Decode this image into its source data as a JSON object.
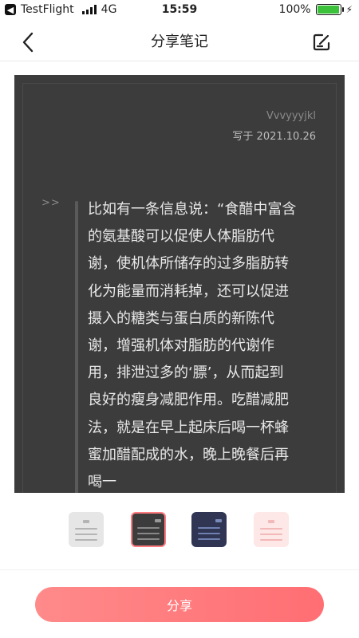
{
  "status_bar": {
    "carrier": "TestFlight",
    "network": "4G",
    "time": "15:59",
    "battery": "100%"
  },
  "header": {
    "title": "分享笔记",
    "icons": [
      "back-icon",
      "edit-icon"
    ]
  },
  "note": {
    "author": "Vvvyyyjkl",
    "date": "写于 2021.10.26",
    "quote_mark": ">>",
    "content": "比如有一条信息说：“食醋中富含的氨基酸可以促使人体脂肪代谢，使机体所储存的过多脂肪转化为能量而消耗掉，还可以促进摄入的糖类与蛋白质的新陈代谢，增强机体对脂肪的代谢作用，排泄过多的‘膘’，从而起到良好的瘦身减肥作用。吃醋减肥法，就是在早上起床后喝一杯蜂蜜加醋配成的水，晚上晚餐后再喝一"
  },
  "themes": [
    {
      "name": "light-gray",
      "color": "#e6e6e6",
      "selected": false
    },
    {
      "name": "dark",
      "color": "#3c3c3c",
      "selected": true
    },
    {
      "name": "navy",
      "color": "#2f3553",
      "selected": false
    },
    {
      "name": "pink",
      "color": "#fde7e7",
      "selected": false
    }
  ],
  "share_label": "分享",
  "colors": {
    "accent": "#ff7b7f",
    "card_bg": "#3c3c3c",
    "battery": "#3cc13b"
  }
}
